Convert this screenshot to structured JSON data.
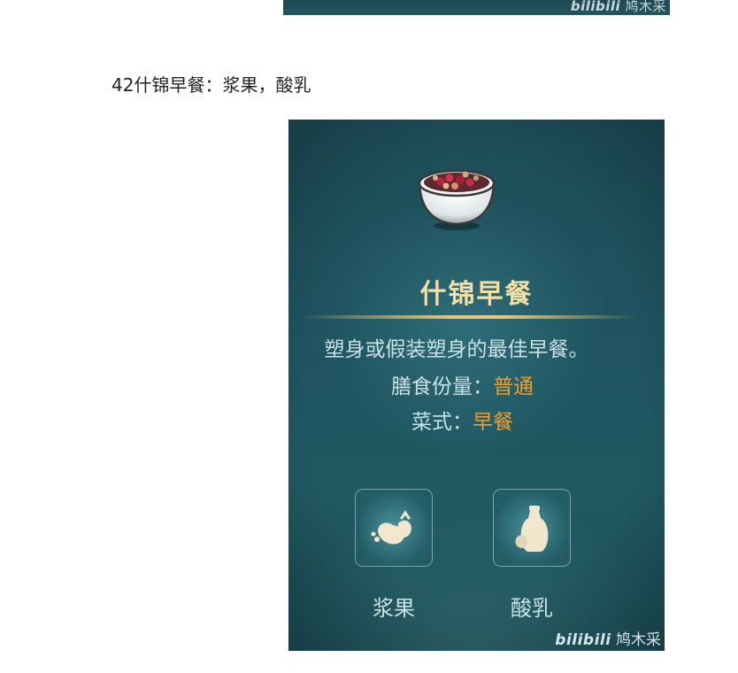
{
  "previous_image": {
    "watermark_brand": "bilibili",
    "watermark_author": "鸠木采"
  },
  "caption": "42什锦早餐：浆果，酸乳",
  "card": {
    "title": "什锦早餐",
    "description": "塑身或假装塑身的最佳早餐。",
    "portion_label": "膳食份量：",
    "portion_value": "普通",
    "style_label": "菜式：",
    "style_value": "早餐",
    "ingredients": [
      {
        "label": "浆果",
        "icon": "berry-icon"
      },
      {
        "label": "酸乳",
        "icon": "yogurt-icon"
      }
    ],
    "watermark_brand": "bilibili",
    "watermark_author": "鸠木采"
  },
  "colors": {
    "title": "#f3dfa2",
    "accent_value": "#e6a13a",
    "card_bg": "#1f5460",
    "text": "#c9e2e6"
  }
}
